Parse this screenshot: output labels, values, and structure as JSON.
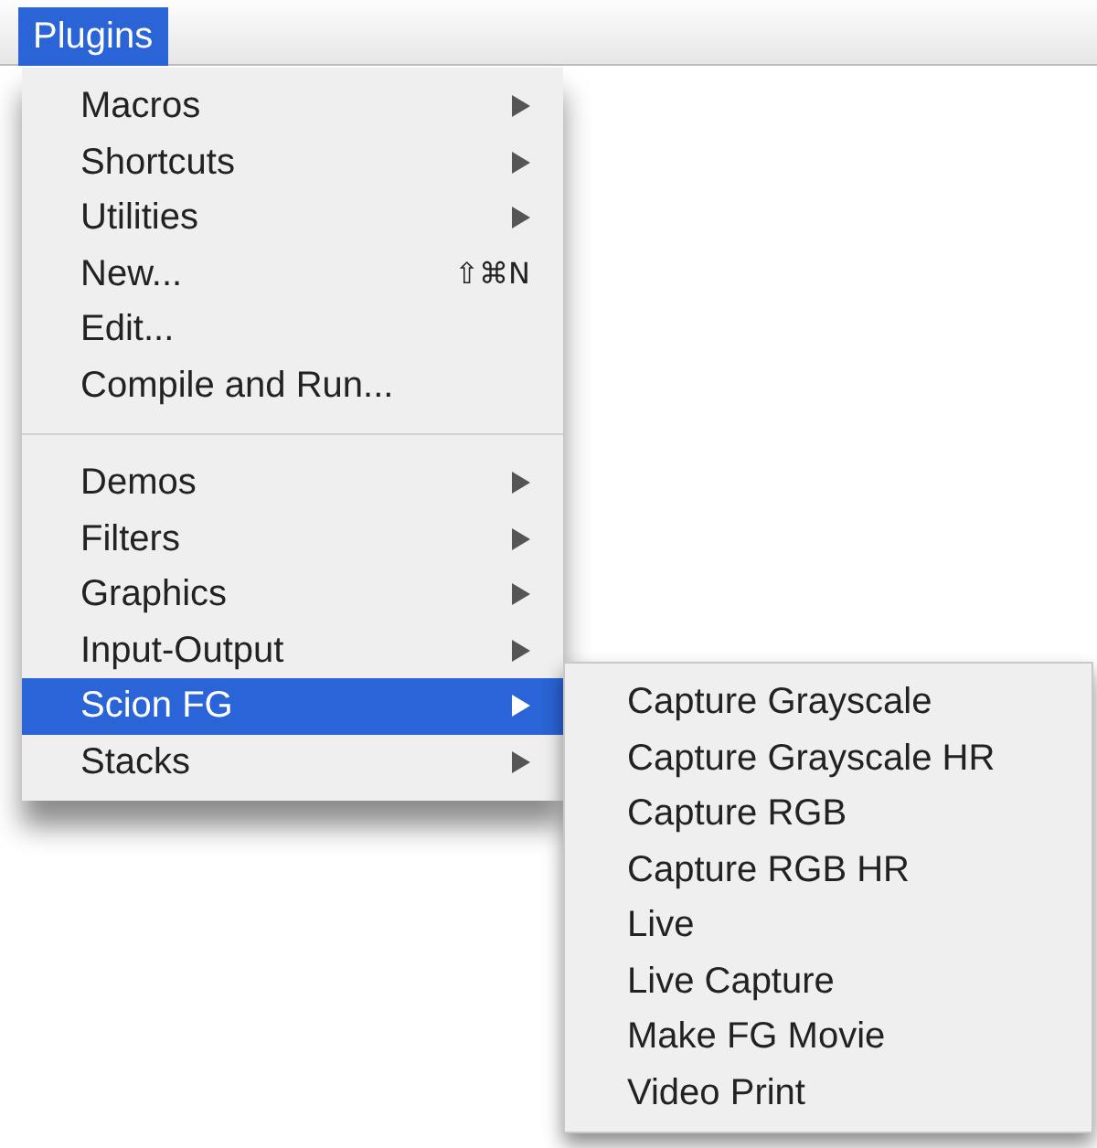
{
  "menu_bar": {
    "menus": [
      {
        "label": "Plugins",
        "selected": true
      }
    ]
  },
  "menu": {
    "items": [
      {
        "kind": "submenu",
        "label": "Macros",
        "selected": false
      },
      {
        "kind": "submenu",
        "label": "Shortcuts",
        "selected": false
      },
      {
        "kind": "submenu",
        "label": "Utilities",
        "selected": false
      },
      {
        "kind": "command",
        "label": "New...",
        "shortcut": "⇧⌘N",
        "selected": false
      },
      {
        "kind": "command",
        "label": "Edit...",
        "selected": false
      },
      {
        "kind": "command",
        "label": "Compile and Run...",
        "selected": false
      },
      {
        "kind": "separator"
      },
      {
        "kind": "submenu",
        "label": "Demos",
        "selected": false
      },
      {
        "kind": "submenu",
        "label": "Filters",
        "selected": false
      },
      {
        "kind": "submenu",
        "label": "Graphics",
        "selected": false
      },
      {
        "kind": "submenu",
        "label": "Input-Output",
        "selected": false
      },
      {
        "kind": "submenu",
        "label": "Scion FG",
        "selected": true
      },
      {
        "kind": "submenu",
        "label": "Stacks",
        "selected": false
      }
    ]
  },
  "submenu": {
    "items": [
      {
        "kind": "command",
        "label": "Capture Grayscale",
        "selected": false
      },
      {
        "kind": "command",
        "label": "Capture Grayscale HR",
        "selected": false
      },
      {
        "kind": "command",
        "label": "Capture RGB",
        "selected": false
      },
      {
        "kind": "command",
        "label": "Capture RGB HR",
        "selected": false
      },
      {
        "kind": "command",
        "label": "Live",
        "selected": false
      },
      {
        "kind": "command",
        "label": "Live Capture",
        "selected": false
      },
      {
        "kind": "command",
        "label": "Make FG Movie",
        "selected": false
      },
      {
        "kind": "command",
        "label": "Video Print",
        "selected": false
      }
    ]
  }
}
